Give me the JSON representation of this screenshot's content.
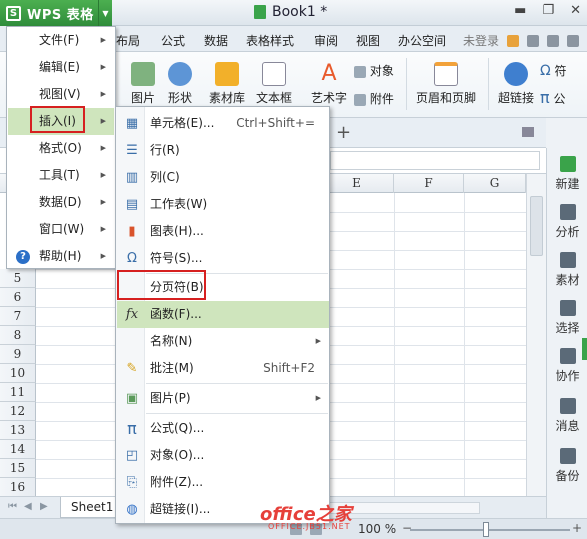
{
  "app": {
    "button_label": "WPS 表格",
    "logo_glyph": "S",
    "doc_title": "Book1 *"
  },
  "tabs": {
    "partial_layout": "布局",
    "formula": "公式",
    "data": "数据",
    "table_style": "表格样式",
    "review": "审阅",
    "view": "视图",
    "office_space": "办公空间",
    "not_logged_in": "未登录"
  },
  "ribbon": {
    "picture": "图片",
    "shape": "形状",
    "clipart": "素材库",
    "textbox": "文本框",
    "wordart": "艺术字",
    "object": "对象",
    "attachment": "附件",
    "header_footer": "页眉和页脚",
    "hyperlink": "超链接",
    "symbol": "符",
    "formula": "公"
  },
  "main_menu": {
    "items": [
      {
        "label": "文件(F)",
        "submenu": true
      },
      {
        "label": "编辑(E)",
        "submenu": true
      },
      {
        "label": "视图(V)",
        "submenu": true
      },
      {
        "label": "插入(I)",
        "submenu": true,
        "active": true
      },
      {
        "label": "格式(O)",
        "submenu": true
      },
      {
        "label": "工具(T)",
        "submenu": true
      },
      {
        "label": "数据(D)",
        "submenu": true
      },
      {
        "label": "窗口(W)",
        "submenu": true
      },
      {
        "label": "帮助(H)",
        "submenu": true
      }
    ]
  },
  "insert_menu": {
    "items": [
      {
        "label": "单元格(E)...",
        "shortcut": "Ctrl+Shift+="
      },
      {
        "label": "行(R)",
        "shortcut": ""
      },
      {
        "label": "列(C)",
        "shortcut": ""
      },
      {
        "label": "工作表(W)",
        "shortcut": ""
      },
      {
        "label": "图表(H)...",
        "shortcut": ""
      },
      {
        "label": "符号(S)...",
        "shortcut": ""
      },
      {
        "label": "分页符(B)",
        "shortcut": ""
      },
      {
        "label": "函数(F)...",
        "shortcut": "",
        "active": true
      },
      {
        "label": "名称(N)",
        "shortcut": "",
        "submenu": true
      },
      {
        "label": "批注(M)",
        "shortcut": "Shift+F2"
      },
      {
        "label": "图片(P)",
        "shortcut": "",
        "submenu": true
      },
      {
        "label": "公式(Q)...",
        "shortcut": ""
      },
      {
        "label": "对象(O)...",
        "shortcut": ""
      },
      {
        "label": "附件(Z)...",
        "shortcut": ""
      },
      {
        "label": "超链接(I)...",
        "shortcut": ""
      }
    ]
  },
  "grid": {
    "columns": [
      "E",
      "F",
      "G"
    ],
    "rows": [
      "5",
      "6",
      "7",
      "8",
      "9",
      "10",
      "11",
      "12",
      "13",
      "14",
      "15",
      "16"
    ]
  },
  "task_pane": {
    "items": [
      "新建",
      "分析",
      "素材",
      "选择",
      "协作",
      "消息",
      "备份"
    ]
  },
  "sheet": {
    "tab_label": "Sheet1"
  },
  "status": {
    "zoom": "100 %"
  },
  "watermark": {
    "main": "office之家",
    "sub": "OFFICE.JB51.NET"
  },
  "colors": {
    "accent_green": "#3aa34a",
    "highlight_green": "#cfe5bd",
    "annotation_red": "#d62020"
  }
}
